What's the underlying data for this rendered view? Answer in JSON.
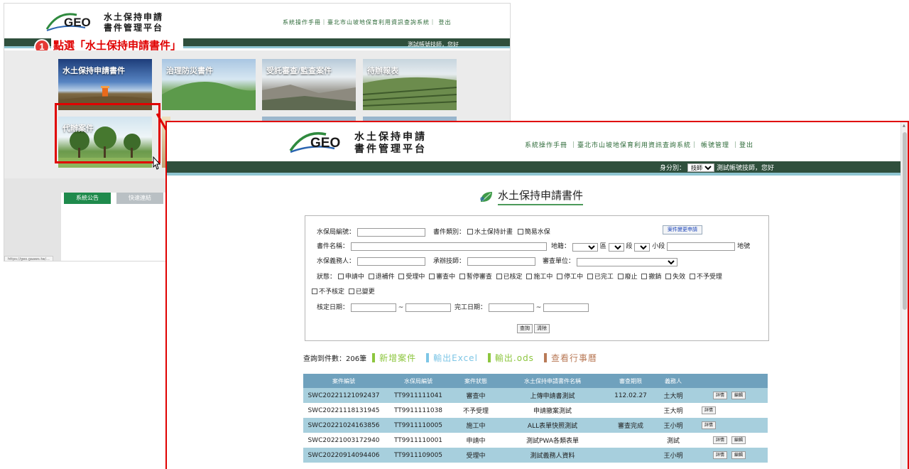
{
  "back": {
    "logo_text": "GEO",
    "logo_title_line1": "水土保持申請",
    "logo_title_line2": "書件管理平台",
    "top_links": "系統操作手冊｜臺北市山坡地保育利用資訊查詢系統｜ 登出",
    "user_greeting": "測試帳號技師，您好",
    "step_number": "1",
    "step_instruction": "點選「水土保持申請書件」",
    "tiles": [
      "水土保持申請書件",
      "治理防災書件",
      "受託審查/監查案件",
      "待辦報表",
      "代辦案件"
    ],
    "notice_tabs": [
      "系統公告",
      "快速連結"
    ],
    "status_url": "https://geo.gaaws.tw/..."
  },
  "front": {
    "logo_text": "GEO",
    "logo_title_line1": "水土保持申請",
    "logo_title_line2": "書件管理平台",
    "top_links": [
      "系統操作手冊",
      "｜臺北市山坡地保育利用資訊查詢系統｜",
      "帳號管理",
      "｜登出"
    ],
    "identity_label": "身分別：",
    "identity_value": "技師",
    "user_greeting": "測試帳號技師，您好",
    "page_title": "水土保持申請書件",
    "search": {
      "bureau_no_label": "水保局編號：",
      "doc_type_label": "書件類別：",
      "doc_type_options": [
        "水土保持計畫",
        "簡易水保"
      ],
      "change_btn": "案件變更申請",
      "doc_name_label": "書件名稱：",
      "land_label": "地籍：",
      "district_suffix": "區",
      "section_suffix": "段",
      "subsection_label": "小段",
      "lot_label": "地號",
      "obligor_label": "水保義務人：",
      "engineer_label": "承辦技師：",
      "review_unit_label": "審查單位：",
      "status_label": "狀態：",
      "status_options": [
        "申請中",
        "退補件",
        "受理中",
        "審查中",
        "暫停審查",
        "已核定",
        "施工中",
        "停工中",
        "已完工",
        "廢止",
        "撤銷",
        "失效",
        "不予受理"
      ],
      "status_options_row2": [
        "不予核定",
        "已變更"
      ],
      "approve_date_label": "核定日期：",
      "complete_date_label": "完工日期：",
      "range_sep": "~",
      "query_btn": "查詢",
      "clear_btn": "清除"
    },
    "actions": {
      "count_text": "查詢到件數：206筆",
      "new_case": "新增案件",
      "export_excel": "輸出Excel",
      "export_ods": "輸出.ods",
      "view_calendar": "查看行事曆",
      "colors": {
        "new_case": "#8dc63f",
        "export_excel": "#7ec6e6",
        "export_ods": "#8dc63f",
        "view_calendar": "#b97a57"
      }
    },
    "table": {
      "headers": [
        "案件編號",
        "水保局編號",
        "案件狀態",
        "水土保持申請書件名稱",
        "審查期限",
        "義務人",
        ""
      ],
      "detail_btn": "詳情",
      "edit_btn": "編輯",
      "rows": [
        {
          "case_no": "SWC20221121092437",
          "bureau_no": "TT9911111041",
          "status": "審查中",
          "name": "上傳申請書測試",
          "deadline": "112.02.27",
          "obligor": "土大明",
          "edit": true
        },
        {
          "case_no": "SWC20221118131945",
          "bureau_no": "TT9911111038",
          "status": "不予受理",
          "name": "申請撤案測試",
          "deadline": "",
          "obligor": "王大明",
          "edit": false
        },
        {
          "case_no": "SWC20221024163856",
          "bureau_no": "TT9911110005",
          "status": "施工中",
          "name": "ALL表單快照測試",
          "deadline": "審查完成",
          "obligor": "王小明",
          "edit": false
        },
        {
          "case_no": "SWC20221003172940",
          "bureau_no": "TT9911110001",
          "status": "申請中",
          "name": "測試PWA各類表單",
          "deadline": "",
          "obligor": "測試",
          "edit": true
        },
        {
          "case_no": "SWC20220914094406",
          "bureau_no": "TT9911109005",
          "status": "受理中",
          "name": "測試義務人資料",
          "deadline": "",
          "obligor": "王小明",
          "edit": true
        }
      ]
    }
  }
}
